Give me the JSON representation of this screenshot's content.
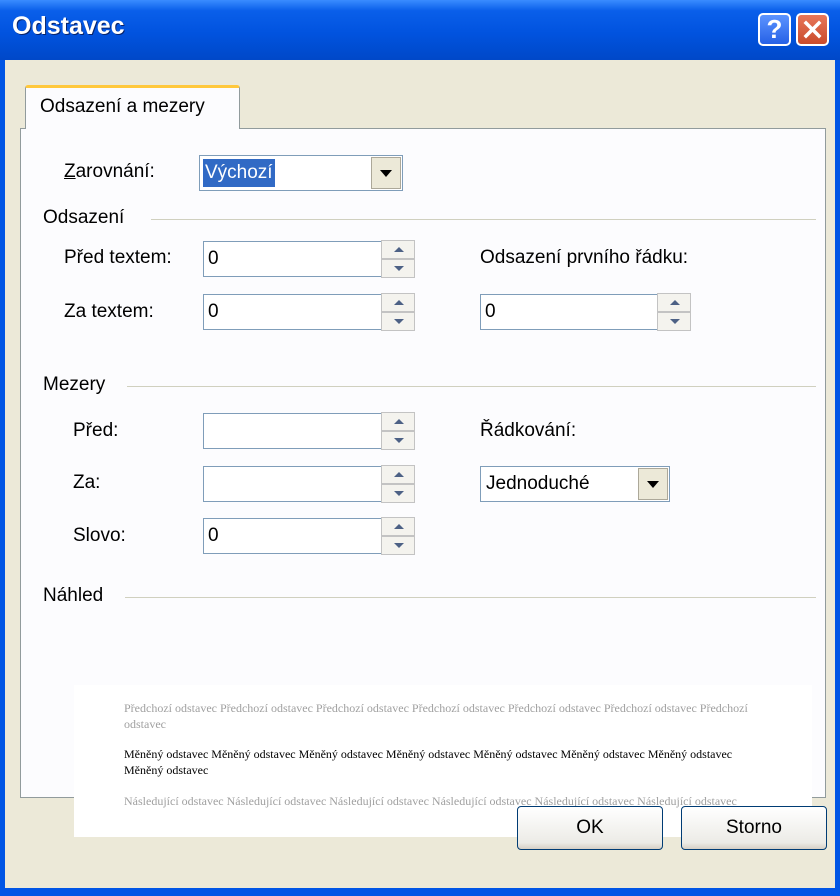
{
  "window": {
    "title": "Odstavec",
    "help_label": "?"
  },
  "tabs": [
    {
      "label": "Odsazení a mezery"
    }
  ],
  "alignment": {
    "label": "Zarovnání:",
    "value": "Výchozí"
  },
  "indent": {
    "section": "Odsazení",
    "before_label": "Před textem:",
    "before_value": "0",
    "after_label": "Za textem:",
    "after_value": "0",
    "first_line_label": "Odsazení prvního řádku:",
    "first_line_value": "0"
  },
  "spacing": {
    "section": "Mezery",
    "before_label": "Před:",
    "before_value": "",
    "after_label": "Za:",
    "after_value": "",
    "word_label": "Slovo:",
    "word_value": "0",
    "line_label": "Řádkování:",
    "line_value": "Jednoduché"
  },
  "preview": {
    "section": "Náhled",
    "previous": "Předchozí odstavec Předchozí odstavec Předchozí odstavec Předchozí odstavec Předchozí odstavec Předchozí odstavec Předchozí odstavec",
    "current": "Měněný odstavec Měněný odstavec Měněný odstavec Měněný odstavec Měněný odstavec Měněný odstavec Měněný odstavec Měněný odstavec",
    "next": "Následující odstavec Následující odstavec Následující odstavec Následující odstavec Následující odstavec Následující odstavec"
  },
  "buttons": {
    "ok": "OK",
    "cancel": "Storno"
  }
}
